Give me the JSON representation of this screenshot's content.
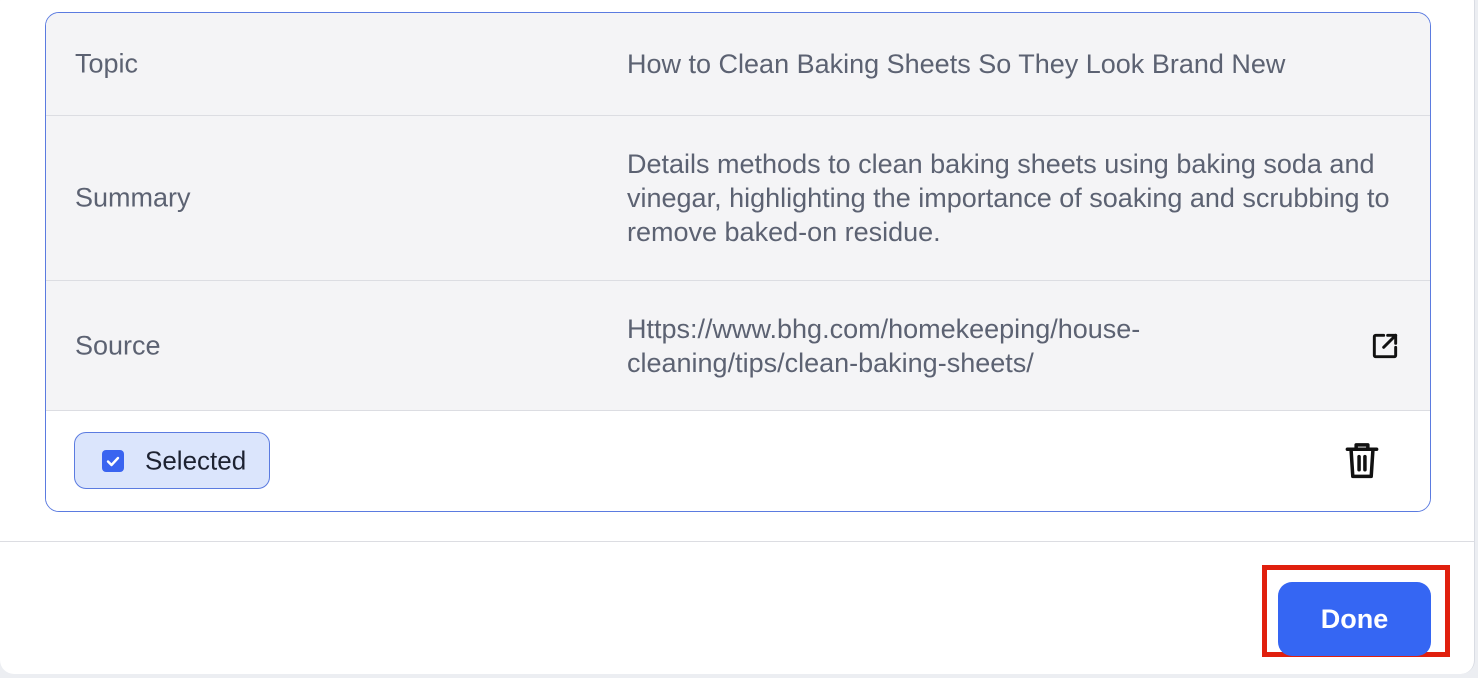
{
  "detail": {
    "rows": [
      {
        "label": "Topic",
        "value": "How to Clean Baking Sheets So They Look Brand New"
      },
      {
        "label": "Summary",
        "value": "Details methods to clean baking sheets using baking soda and vinegar, highlighting the importance of soaking and scrubbing to remove baked-on residue."
      },
      {
        "label": "Source",
        "value": "Https://www.bhg.com/homekeeping/house-cleaning/tips/clean-baking-sheets/",
        "icon": "external-link-icon"
      }
    ],
    "selected": {
      "label": "Selected",
      "checked": true,
      "icon": "checkmark-icon"
    },
    "delete_icon": "trash-icon"
  },
  "footer": {
    "done_label": "Done"
  },
  "colors": {
    "accent": "#3566f3",
    "chip_background": "#dbe5fc",
    "card_border": "#5b7be0",
    "highlight": "#e0200e"
  }
}
